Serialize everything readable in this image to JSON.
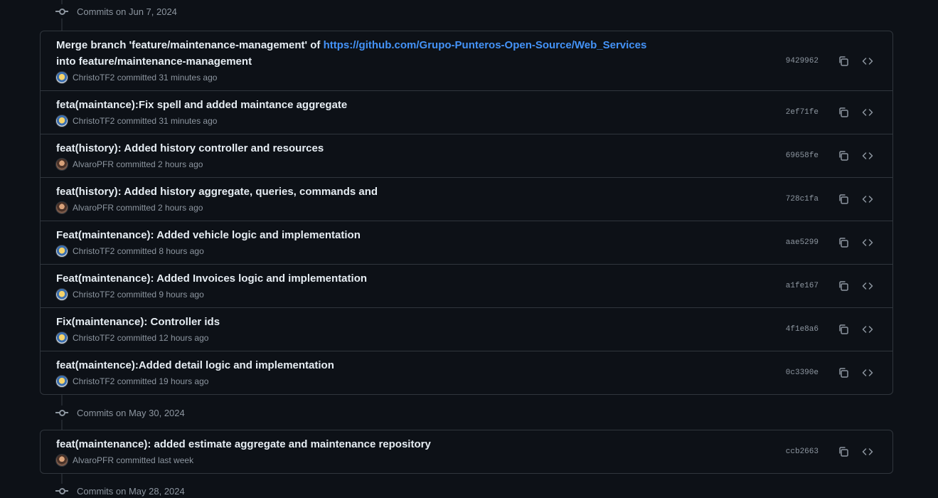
{
  "groups": [
    {
      "header": "Commits on Jun 7, 2024",
      "commits": [
        {
          "msg_before": "Merge branch 'feature/maintenance-management' of ",
          "link": "https://github.com/Grupo-Punteros-Open-Source/Web_Services",
          "msg_after": " into feature/maintenance-management",
          "author": "ChristoTF2",
          "time": "committed 31 minutes ago",
          "sha": "9429962",
          "avatar": "christo"
        },
        {
          "msg": "feta(maintance):Fix spell and added maintance aggregate",
          "author": "ChristoTF2",
          "time": "committed 31 minutes ago",
          "sha": "2ef71fe",
          "avatar": "christo"
        },
        {
          "msg": "feat(history): Added history controller and resources",
          "author": "AlvaroPFR",
          "time": "committed 2 hours ago",
          "sha": "69658fe",
          "avatar": "alvaro"
        },
        {
          "msg": "feat(history): Added history aggregate, queries, commands and",
          "author": "AlvaroPFR",
          "time": "committed 2 hours ago",
          "sha": "728c1fa",
          "avatar": "alvaro"
        },
        {
          "msg": "Feat(maintenance): Added vehicle logic and implementation",
          "author": "ChristoTF2",
          "time": "committed 8 hours ago",
          "sha": "aae5299",
          "avatar": "christo"
        },
        {
          "msg": "Feat(maintenance): Added Invoices logic and implementation",
          "author": "ChristoTF2",
          "time": "committed 9 hours ago",
          "sha": "a1fe167",
          "avatar": "christo"
        },
        {
          "msg": "Fix(maintenance): Controller ids",
          "author": "ChristoTF2",
          "time": "committed 12 hours ago",
          "sha": "4f1e8a6",
          "avatar": "christo"
        },
        {
          "msg": "feat(maintence):Added detail logic and implementation",
          "author": "ChristoTF2",
          "time": "committed 19 hours ago",
          "sha": "0c3390e",
          "avatar": "christo"
        }
      ]
    },
    {
      "header": "Commits on May 30, 2024",
      "commits": [
        {
          "msg": "feat(maintenance): added estimate aggregate and maintenance repository",
          "author": "AlvaroPFR",
          "time": "committed last week",
          "sha": "ccb2663",
          "avatar": "alvaro"
        }
      ]
    }
  ],
  "next_group_header": "Commits on May 28, 2024",
  "icons": {
    "commit": "git-commit-icon",
    "copy": "copy-icon",
    "browse": "code-icon"
  },
  "colors": {
    "background": "#0d1117",
    "border": "#30363d",
    "link": "#4493f8",
    "muted": "#8d96a0"
  }
}
